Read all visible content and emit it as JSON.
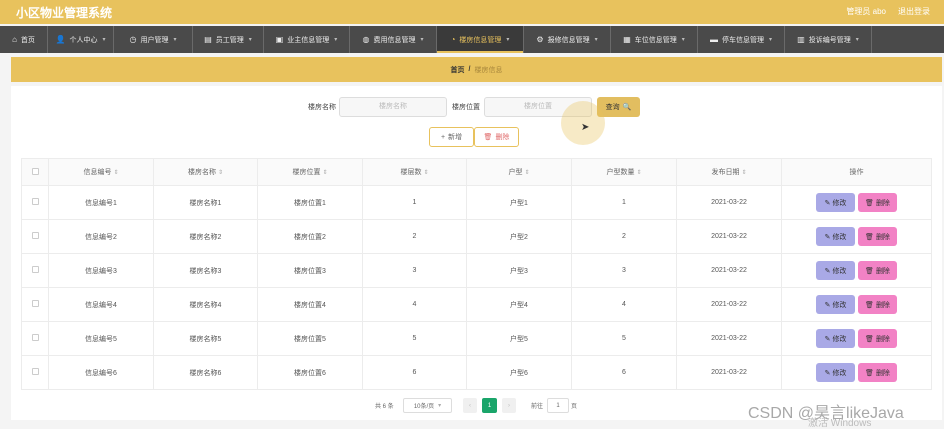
{
  "header": {
    "title": "小区物业管理系统",
    "admin": "管理员 abo",
    "logout": "退出登录"
  },
  "nav": [
    {
      "label": "首页",
      "icon": "⌂",
      "caret": false
    },
    {
      "label": "个人中心",
      "icon": "👤",
      "caret": true
    },
    {
      "label": "用户管理",
      "icon": "◷",
      "caret": true
    },
    {
      "label": "员工管理",
      "icon": "▤",
      "caret": true
    },
    {
      "label": "业主信息管理",
      "icon": "▣",
      "caret": true
    },
    {
      "label": "费用信息管理",
      "icon": "◍",
      "caret": true
    },
    {
      "label": "楼房信息管理",
      "icon": "◔",
      "caret": true
    },
    {
      "label": "报修信息管理",
      "icon": "⚙",
      "caret": true
    },
    {
      "label": "车位信息管理",
      "icon": "▦",
      "caret": true
    },
    {
      "label": "停车信息管理",
      "icon": "▬",
      "caret": true
    },
    {
      "label": "投诉编号管理",
      "icon": "▥",
      "caret": true
    }
  ],
  "breadcrumb": {
    "home": "首页",
    "sep": "/",
    "current": "楼房信息"
  },
  "search": {
    "name_label": "楼房名称",
    "name_placeholder": "楼房名称",
    "location_label": "楼房位置",
    "location_placeholder": "楼房位置",
    "query": "查询",
    "query_icon": "🔍"
  },
  "actions": {
    "add_icon": "+",
    "add": "新增",
    "delete_icon": "🗑",
    "delete": "删除"
  },
  "table": {
    "columns": [
      "信息编号",
      "楼房名称",
      "楼房位置",
      "楼层数",
      "户型",
      "户型数量",
      "发布日期",
      "操作"
    ],
    "rows": [
      [
        "信息编号1",
        "楼房名称1",
        "楼房位置1",
        "1",
        "户型1",
        "1",
        "2021-03-22"
      ],
      [
        "信息编号2",
        "楼房名称2",
        "楼房位置2",
        "2",
        "户型2",
        "2",
        "2021-03-22"
      ],
      [
        "信息编号3",
        "楼房名称3",
        "楼房位置3",
        "3",
        "户型3",
        "3",
        "2021-03-22"
      ],
      [
        "信息编号4",
        "楼房名称4",
        "楼房位置4",
        "4",
        "户型4",
        "4",
        "2021-03-22"
      ],
      [
        "信息编号5",
        "楼房名称5",
        "楼房位置5",
        "5",
        "户型5",
        "5",
        "2021-03-22"
      ],
      [
        "信息编号6",
        "楼房名称6",
        "楼房位置6",
        "6",
        "户型6",
        "6",
        "2021-03-22"
      ]
    ],
    "edit_icon": "✎",
    "edit_label": "修改",
    "delete_icon": "🗑",
    "delete_label": "删除"
  },
  "pagination": {
    "total": "共 6 条",
    "page_size": "10条/页",
    "prev": "‹",
    "current": "1",
    "next": "›",
    "goto": "前往",
    "jump_value": "1",
    "unit": "页"
  },
  "overlay": {
    "watermark": "CSDN @昊言likeJava",
    "windows": "激活 Windows"
  },
  "colors": {
    "accent": "#e8c25d",
    "nav_bg": "#4a4a4a",
    "edit": "#a9a9e6",
    "delete": "#f282c5",
    "page_active": "#1aa56a"
  }
}
